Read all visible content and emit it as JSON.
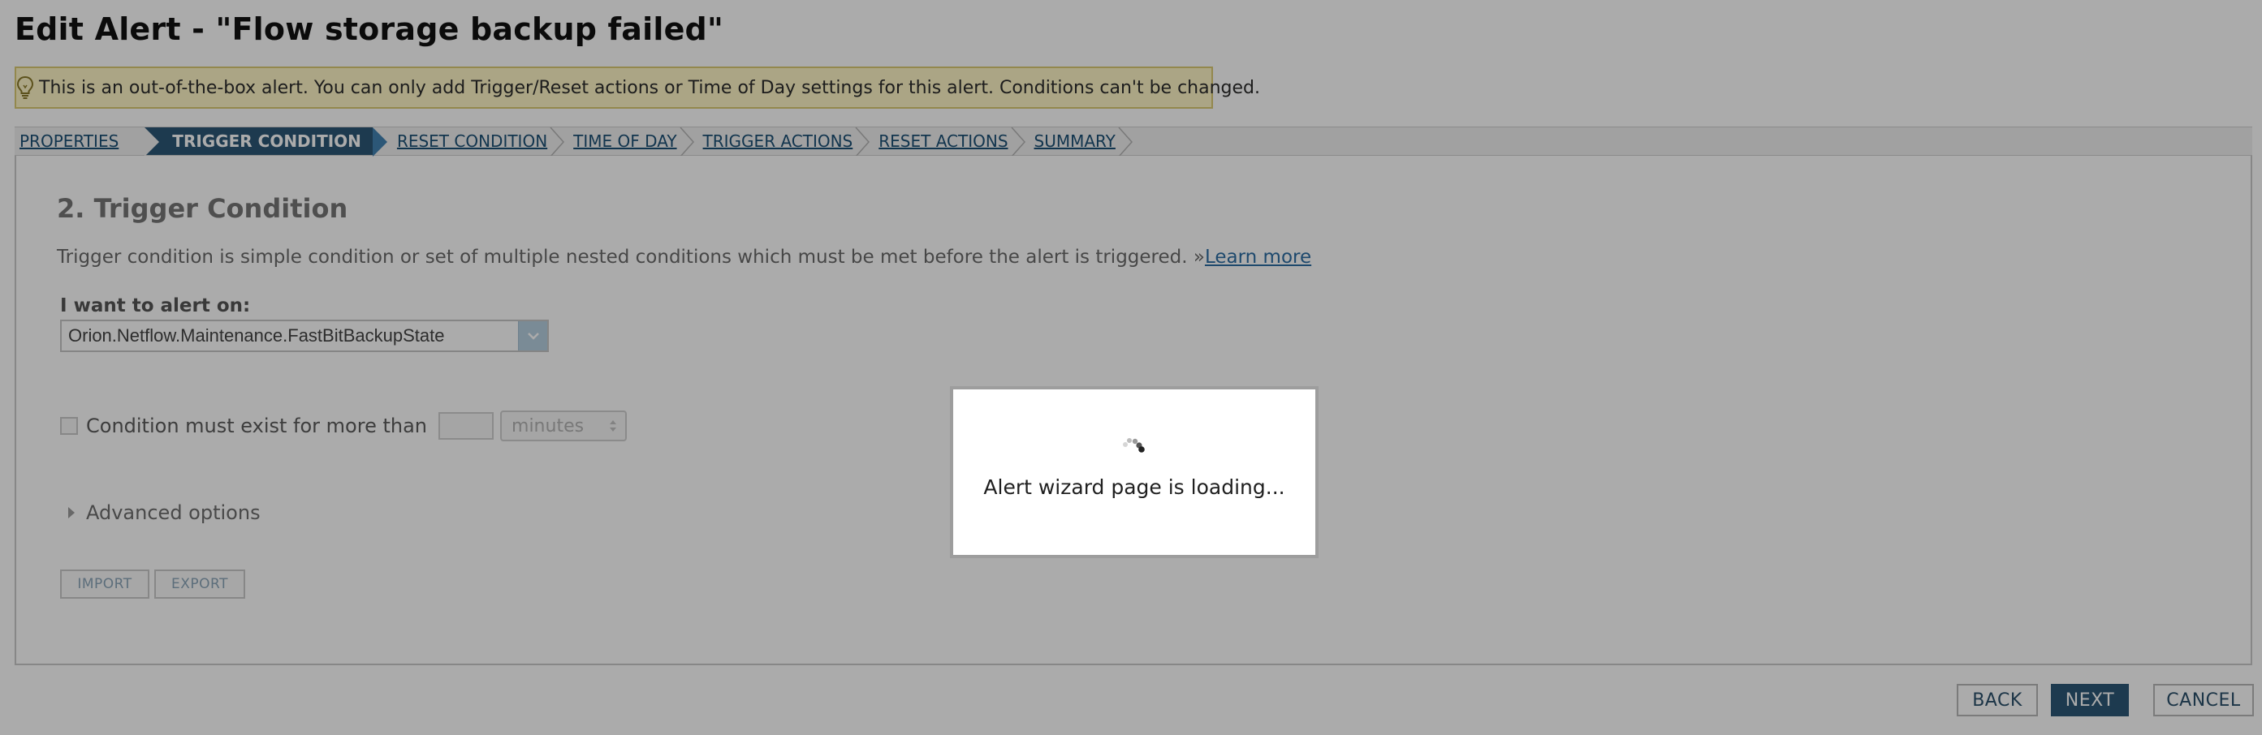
{
  "header": {
    "title": "Edit Alert - \"Flow storage backup failed\""
  },
  "banner": {
    "icon": "lightbulb-icon",
    "text": "This is an out-of-the-box alert. You can only add Trigger/Reset actions or Time of Day settings for this alert. Conditions can't be changed."
  },
  "steps": [
    {
      "label": "PROPERTIES",
      "active": false
    },
    {
      "label": "TRIGGER CONDITION",
      "active": true
    },
    {
      "label": "RESET CONDITION",
      "active": false
    },
    {
      "label": "TIME OF DAY",
      "active": false
    },
    {
      "label": "TRIGGER ACTIONS",
      "active": false
    },
    {
      "label": "RESET ACTIONS",
      "active": false
    },
    {
      "label": "SUMMARY",
      "active": false
    }
  ],
  "section": {
    "title": "2. Trigger Condition",
    "description": "Trigger condition is simple condition or set of multiple nested conditions which must be met before the alert is triggered. »",
    "learn_more": "Learn more",
    "alert_on_label": "I want to alert on:",
    "alert_on_value": "Orion.Netflow.Maintenance.FastBitBackupState",
    "condition_label": "Condition must exist for more than",
    "condition_value": "",
    "condition_unit": "minutes",
    "advanced_label": "Advanced options",
    "import_label": "IMPORT",
    "export_label": "EXPORT"
  },
  "footer": {
    "back": "BACK",
    "next": "NEXT",
    "cancel": "CANCEL"
  },
  "modal": {
    "text": "Alert wizard page is loading..."
  },
  "colors": {
    "accent": "#2c5777",
    "link": "#1b4f75",
    "banner_bg": "#fff7c7",
    "overlay": "rgba(0,0,0,0.33)"
  }
}
